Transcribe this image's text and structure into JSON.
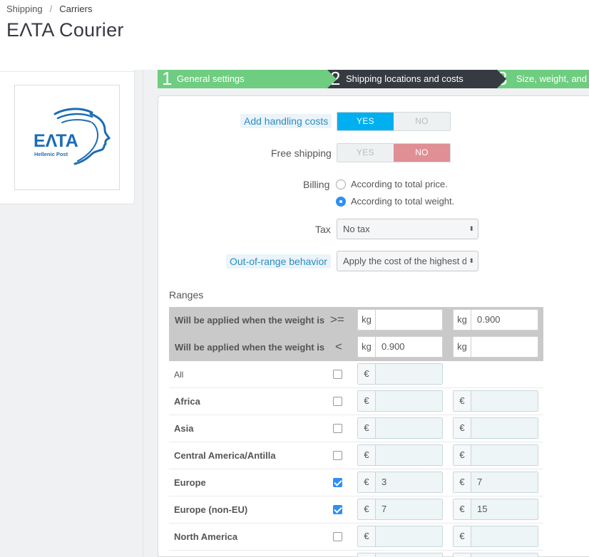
{
  "breadcrumb": {
    "parent": "Shipping",
    "separator": "/",
    "current": "Carriers"
  },
  "page_title": "ΕΛΤΑ Courier",
  "logo": {
    "brand": "ΕΛΤΑ",
    "subtitle": "Hellenic Post",
    "color": "#1b6cb5"
  },
  "wizard": {
    "steps": [
      {
        "num": "1",
        "label": "General settings"
      },
      {
        "num": "2",
        "label": "Shipping locations and costs"
      },
      {
        "num": "3",
        "label": "Size, weight, and"
      }
    ],
    "active_color": "#363a41",
    "done_color": "#6ecd80"
  },
  "form": {
    "handling": {
      "label": "Add handling costs",
      "yes": "YES",
      "no": "NO",
      "value": "YES"
    },
    "free_shipping": {
      "label": "Free shipping",
      "yes": "YES",
      "no": "NO",
      "value": "NO"
    },
    "billing": {
      "label": "Billing",
      "options": [
        "According to total price.",
        "According to total weight."
      ],
      "selected": "According to total weight."
    },
    "tax": {
      "label": "Tax",
      "value": "No tax",
      "caret": "⬍"
    },
    "out_of_range": {
      "label": "Out-of-range behavior",
      "value": "Apply the cost of the highest d",
      "caret": "⬍"
    }
  },
  "ranges": {
    "title": "Ranges",
    "header_rows": [
      {
        "label": "Will be applied when the weight is",
        "op": ">=",
        "unit": "kg",
        "values": [
          "",
          "0.900"
        ]
      },
      {
        "label": "Will be applied when the weight is",
        "op": "<",
        "unit": "kg",
        "values": [
          "0.900",
          ""
        ]
      }
    ],
    "currency": "€",
    "zones": [
      {
        "name": "All",
        "checked": false,
        "values": [
          ""
        ]
      },
      {
        "name": "Africa",
        "checked": false,
        "values": [
          "",
          ""
        ]
      },
      {
        "name": "Asia",
        "checked": false,
        "values": [
          "",
          ""
        ]
      },
      {
        "name": "Central America/Antilla",
        "checked": false,
        "values": [
          "",
          ""
        ]
      },
      {
        "name": "Europe",
        "checked": true,
        "values": [
          "3",
          "7"
        ]
      },
      {
        "name": "Europe (non-EU)",
        "checked": true,
        "values": [
          "7",
          "15"
        ]
      },
      {
        "name": "North America",
        "checked": false,
        "values": [
          "",
          ""
        ]
      }
    ]
  }
}
